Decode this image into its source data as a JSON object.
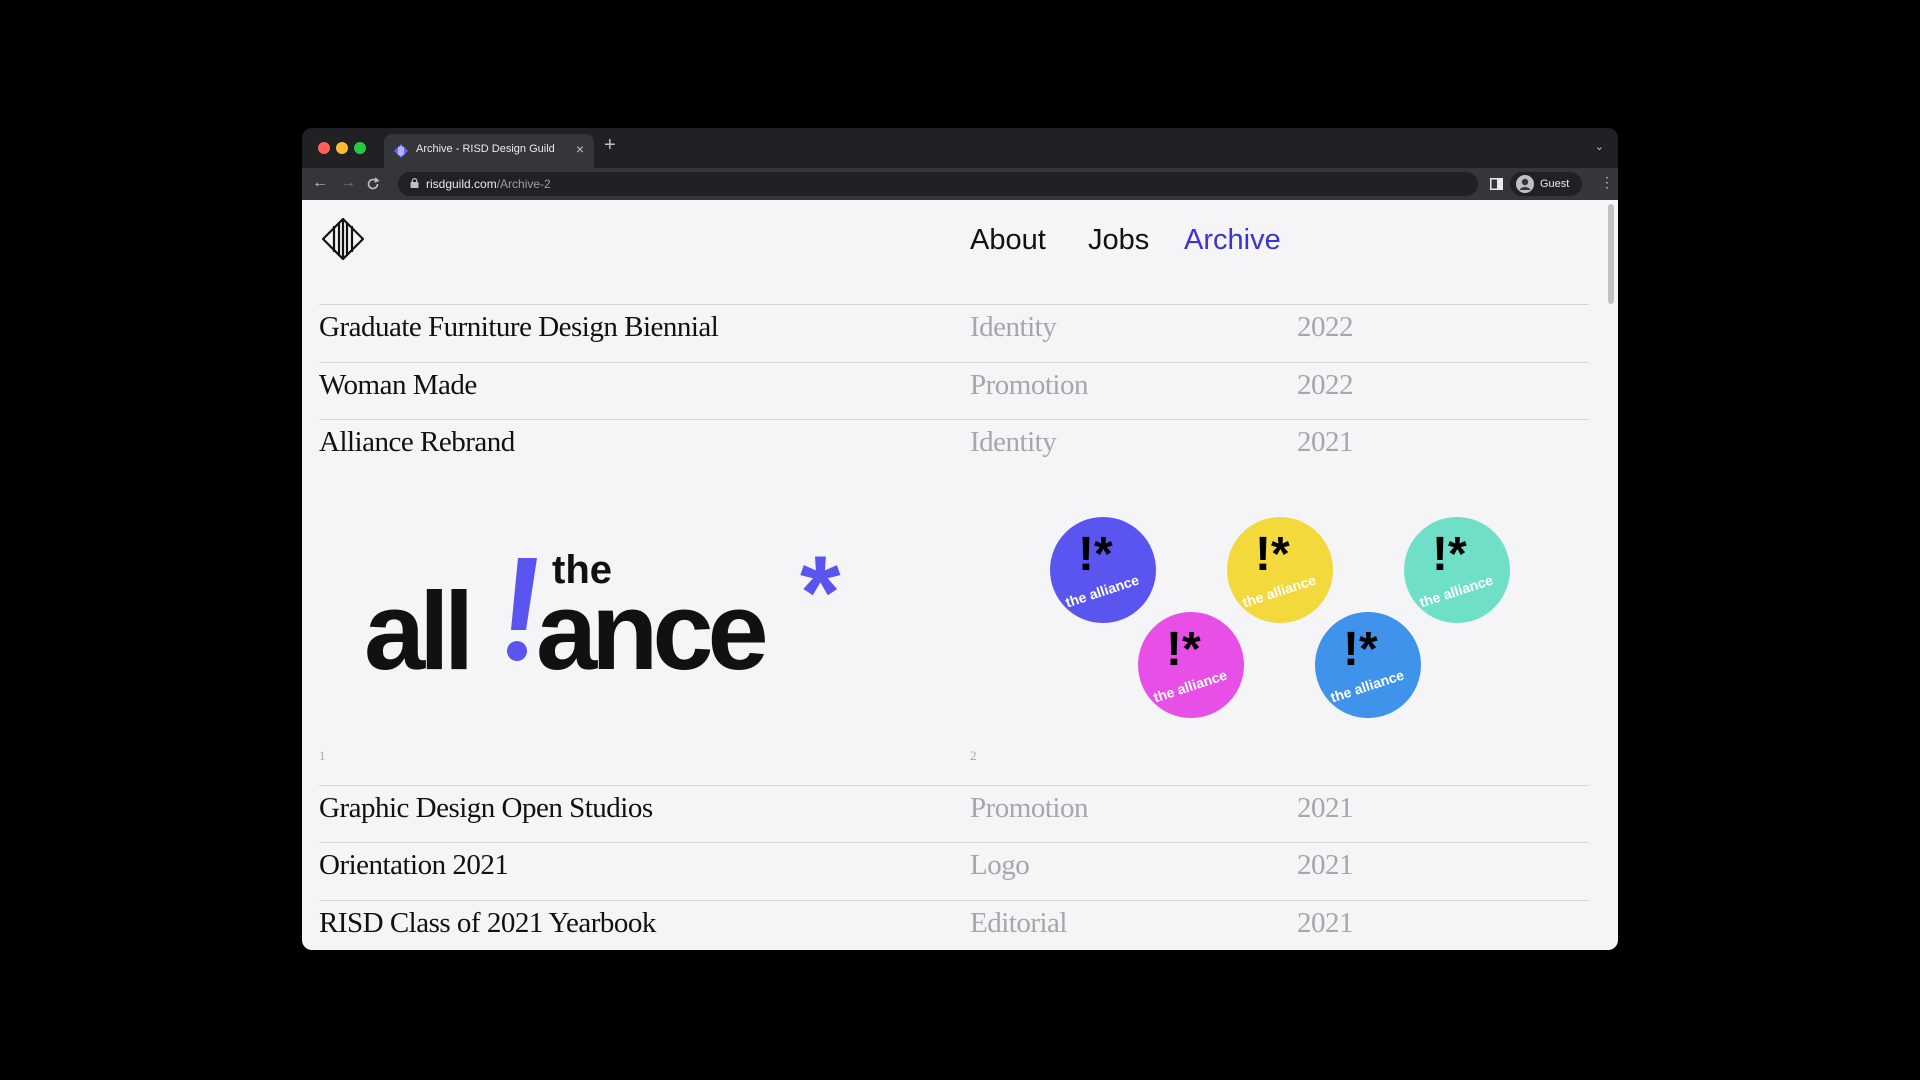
{
  "browser": {
    "tab_title": "Archive - RISD Design Guild",
    "url_domain": "risdguild.com",
    "url_path": "/Archive-2",
    "profile_label": "Guest"
  },
  "nav": {
    "items": [
      "About",
      "Jobs",
      "Archive"
    ],
    "active": "Archive",
    "active_color": "#3d33d4"
  },
  "archive": {
    "rows_top": [
      {
        "title": "Graduate Furniture Design Biennial",
        "category": "Identity",
        "year": "2022"
      },
      {
        "title": "Woman Made",
        "category": "Promotion",
        "year": "2022"
      },
      {
        "title": "Alliance Rebrand",
        "category": "Identity",
        "year": "2021"
      }
    ],
    "expanded": {
      "logo": {
        "word_small": "the",
        "word_a": "all",
        "word_b": "ance",
        "exclaim_color": "#5b55f0",
        "asterisk_color": "#5b55f0"
      },
      "sticker_text": "the alliance",
      "sticker_colors": [
        "#5b55f0",
        "#f4d93c",
        "#6fe0c7",
        "#e84fe6",
        "#3f93ea"
      ],
      "captions": [
        "1",
        "2"
      ]
    },
    "rows_bottom": [
      {
        "title": "Graphic Design Open Studios",
        "category": "Promotion",
        "year": "2021"
      },
      {
        "title": "Orientation 2021",
        "category": "Logo",
        "year": "2021"
      },
      {
        "title": "RISD Class of 2021 Yearbook",
        "category": "Editorial",
        "year": "2021"
      }
    ]
  }
}
